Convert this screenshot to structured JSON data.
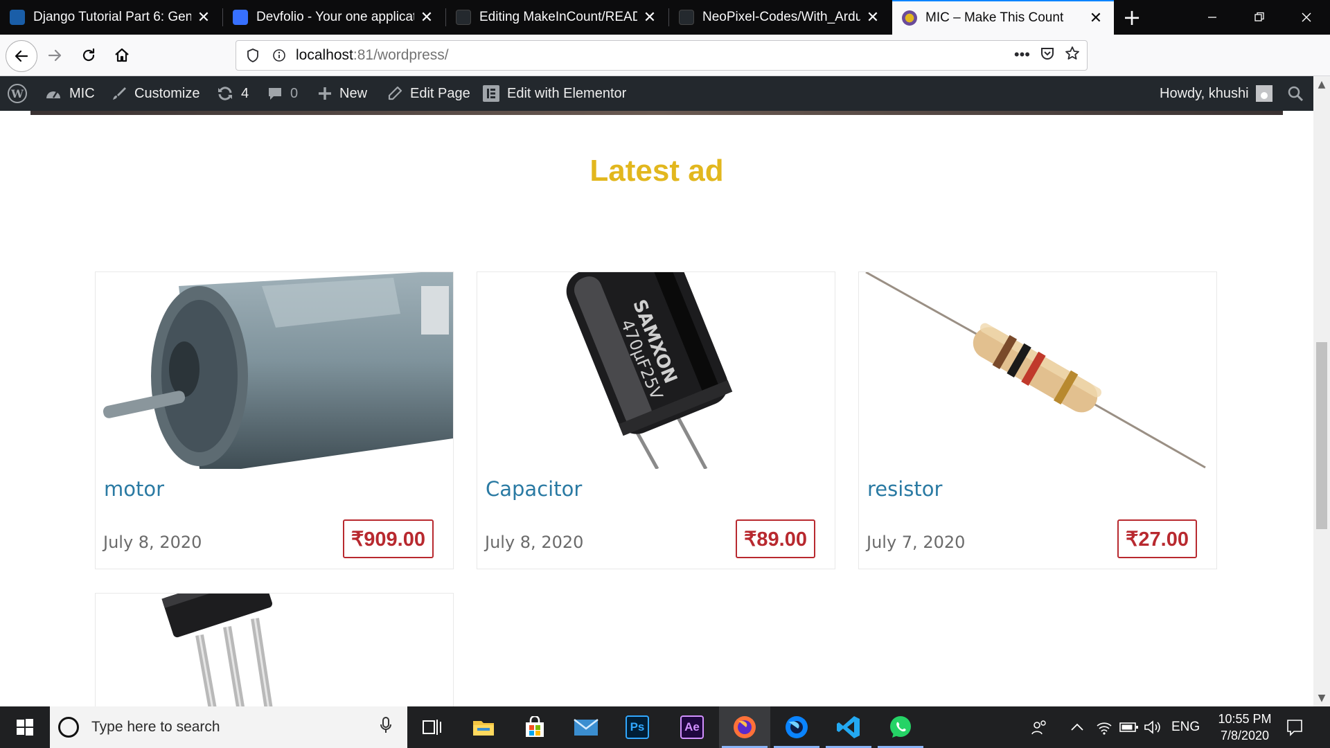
{
  "browser": {
    "tabs": [
      {
        "title": "Django Tutorial Part 6: Gener",
        "favicon_color": "#1a5ea8",
        "active": false
      },
      {
        "title": "Devfolio - Your one applicatio",
        "favicon_color": "#3770ff",
        "active": false
      },
      {
        "title": "Editing MakeInCount/READM",
        "favicon_color": "#24292e",
        "active": false
      },
      {
        "title": "NeoPixel-Codes/With_Arduin",
        "favicon_color": "#24292e",
        "active": false
      },
      {
        "title": "MIC – Make This Count",
        "favicon_color": "#e2b71e",
        "active": true
      }
    ],
    "close_glyph": "✕",
    "new_tab_glyph": "+",
    "url_host": "localhost",
    "url_rest": ":81/wordpress/"
  },
  "admin_bar": {
    "site_name": "MIC",
    "customize": "Customize",
    "updates_count": "4",
    "comments_count": "0",
    "new": "New",
    "edit_page": "Edit Page",
    "edit_elementor": "Edit with Elementor",
    "howdy": "Howdy, khushi"
  },
  "content": {
    "section_title": "Latest ad",
    "ads": [
      {
        "name": "motor",
        "date": "July 8, 2020",
        "price": "₹909.00"
      },
      {
        "name": "Capacitor",
        "date": "July 8, 2020",
        "price": "₹89.00"
      },
      {
        "name": "resistor",
        "date": "July 7, 2020",
        "price": "₹27.00"
      },
      {
        "name": "",
        "date": "",
        "price": ""
      }
    ]
  },
  "taskbar": {
    "search_placeholder": "Type here to search",
    "language": "ENG",
    "time": "10:55 PM",
    "date": "7/8/2020",
    "apps": [
      {
        "name": "task-view",
        "label": ""
      },
      {
        "name": "file-explorer",
        "label": ""
      },
      {
        "name": "microsoft-store",
        "label": ""
      },
      {
        "name": "mail",
        "label": ""
      },
      {
        "name": "photoshop",
        "label": "Ps"
      },
      {
        "name": "after-effects",
        "label": "Ae"
      },
      {
        "name": "firefox",
        "label": ""
      },
      {
        "name": "firefox-dev",
        "label": ""
      },
      {
        "name": "vscode",
        "label": ""
      },
      {
        "name": "whatsapp",
        "label": ""
      }
    ]
  }
}
